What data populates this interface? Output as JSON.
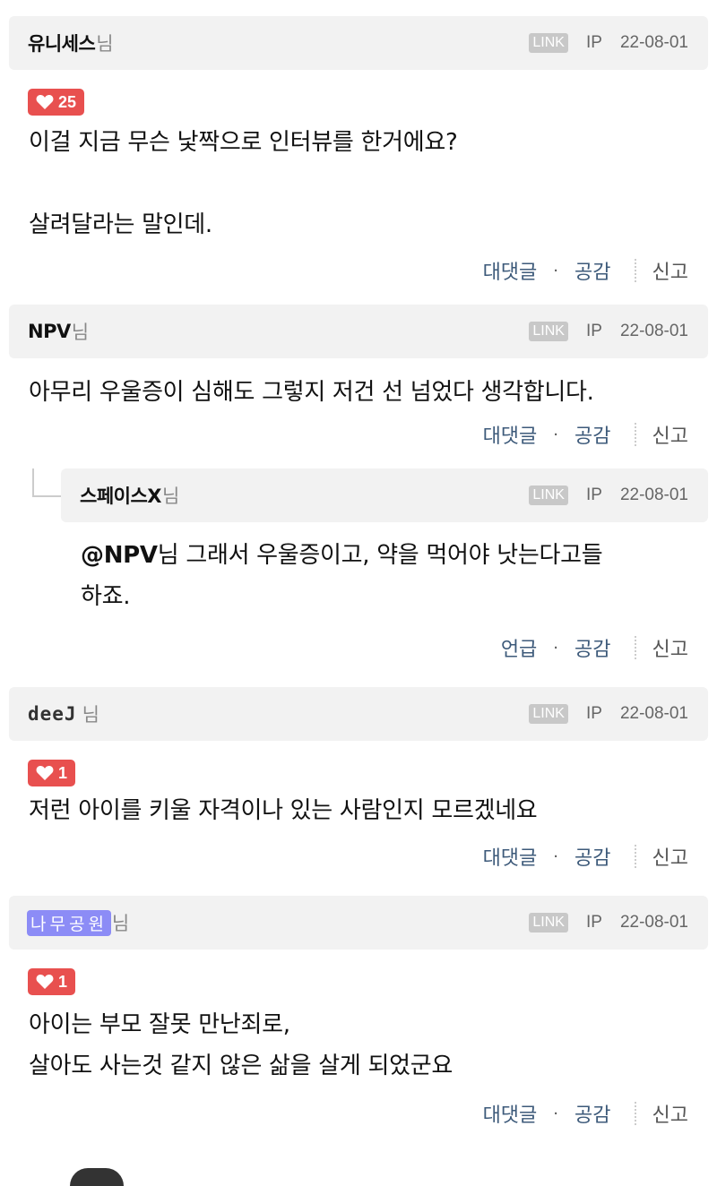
{
  "comments": [
    {
      "author": "유니세스",
      "suffix": "님",
      "link": "LINK",
      "ip": "IP",
      "date": "22-08-01",
      "likes": "25",
      "lines": [
        "이걸 지금 무슨 낯짝으로 인터뷰를 한거에요?",
        "",
        "살려달라는 말인데."
      ],
      "actions": {
        "reply": "대댓글",
        "dot": "·",
        "like": "공감",
        "report": "신고"
      }
    },
    {
      "author": "NPV",
      "suffix": "님",
      "link": "LINK",
      "ip": "IP",
      "date": "22-08-01",
      "lines": [
        "아무리 우울증이 심해도 그렇지 저건 선 넘었다 생각합니다."
      ],
      "actions": {
        "reply": "대댓글",
        "dot": "·",
        "like": "공감",
        "report": "신고"
      }
    },
    {
      "author": "스페이스X",
      "suffix": "님",
      "link": "LINK",
      "ip": "IP",
      "date": "22-08-01",
      "mention": "@NPV",
      "lines": [
        "님 그래서 우울증이고, 약을 먹어야 낫는다고들",
        "하죠."
      ],
      "actions": {
        "reply": "언급",
        "dot": "·",
        "like": "공감",
        "report": "신고"
      }
    },
    {
      "author": "deeJ",
      "suffix": "님",
      "link": "LINK",
      "ip": "IP",
      "date": "22-08-01",
      "likes": "1",
      "lines": [
        "저런 아이를 키울 자격이나 있는 사람인지 모르겠네요"
      ],
      "actions": {
        "reply": "대댓글",
        "dot": "·",
        "like": "공감",
        "report": "신고"
      }
    },
    {
      "author": "나무공원",
      "suffix": "님",
      "link": "LINK",
      "ip": "IP",
      "date": "22-08-01",
      "likes": "1",
      "lines": [
        "아이는 부모 잘못 만난죄로,",
        "살아도 사는것 같지 않은 삶을 살게 되었군요"
      ],
      "actions": {
        "reply": "대댓글",
        "dot": "·",
        "like": "공감",
        "report": "신고"
      }
    }
  ],
  "colors": {
    "like_badge": "#e8504f",
    "header_bg": "#f2f2f2",
    "action_link": "#3d5a7a",
    "namu_badge": "#8c8cf6"
  },
  "icons": {
    "like": "heart-icon"
  }
}
